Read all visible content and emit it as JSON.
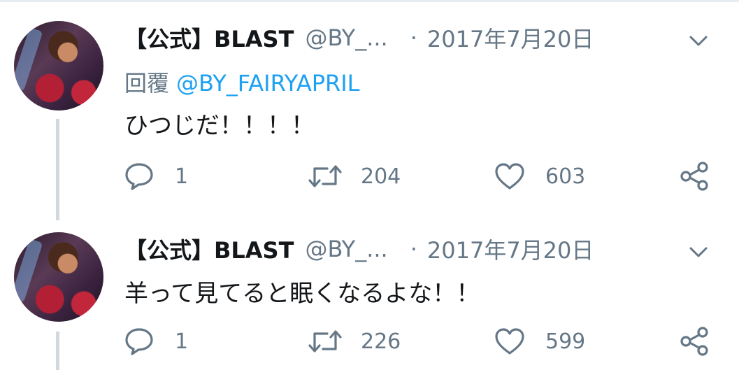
{
  "tweets": [
    {
      "author_name": "【公式】BLAST",
      "author_handle": "@BY_...",
      "separator": "·",
      "date": "2017年7月20日",
      "reply_label": "回覆",
      "reply_to": "@BY_FAIRYAPRIL",
      "text": "ひつじだ！！！！",
      "replies": "1",
      "retweets": "204",
      "likes": "603"
    },
    {
      "author_name": "【公式】BLAST",
      "author_handle": "@BY_...",
      "separator": "·",
      "date": "2017年7月20日",
      "text": "羊って見てると眠くなるよな！！",
      "replies": "1",
      "retweets": "226",
      "likes": "599"
    }
  ],
  "icons": {
    "menu": "chevron-down-icon",
    "reply": "reply-icon",
    "retweet": "retweet-icon",
    "like": "heart-icon",
    "share": "share-icon"
  },
  "colors": {
    "link": "#1da1f2",
    "secondary_text": "#657786",
    "thread_line": "#cfd9de"
  }
}
